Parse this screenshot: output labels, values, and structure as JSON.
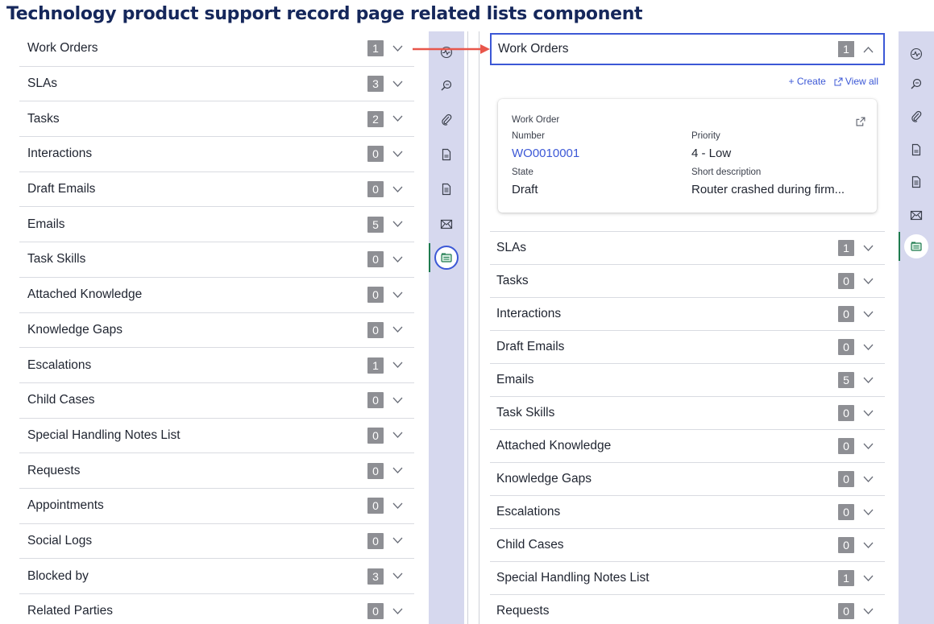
{
  "page_title": "Technology product support record page related lists component",
  "left_list": [
    {
      "label": "Work Orders",
      "count": "1"
    },
    {
      "label": "SLAs",
      "count": "3"
    },
    {
      "label": "Tasks",
      "count": "2"
    },
    {
      "label": "Interactions",
      "count": "0"
    },
    {
      "label": "Draft Emails",
      "count": "0"
    },
    {
      "label": "Emails",
      "count": "5"
    },
    {
      "label": "Task Skills",
      "count": "0"
    },
    {
      "label": "Attached Knowledge",
      "count": "0"
    },
    {
      "label": "Knowledge Gaps",
      "count": "0"
    },
    {
      "label": "Escalations",
      "count": "1"
    },
    {
      "label": "Child Cases",
      "count": "0"
    },
    {
      "label": "Special Handling Notes List",
      "count": "0"
    },
    {
      "label": "Requests",
      "count": "0"
    },
    {
      "label": "Appointments",
      "count": "0"
    },
    {
      "label": "Social Logs",
      "count": "0"
    },
    {
      "label": "Blocked by",
      "count": "3"
    },
    {
      "label": "Related Parties",
      "count": "0"
    }
  ],
  "right_expanded": {
    "label": "Work Orders",
    "count": "1",
    "create_label": "+ Create",
    "view_all_label": "View all",
    "card": {
      "type_label": "Work Order",
      "number_label": "Number",
      "number_value": "WO0010001",
      "priority_label": "Priority",
      "priority_value": "4 - Low",
      "state_label": "State",
      "state_value": "Draft",
      "short_desc_label": "Short description",
      "short_desc_value": "Router crashed during firm..."
    }
  },
  "right_list": [
    {
      "label": "SLAs",
      "count": "1"
    },
    {
      "label": "Tasks",
      "count": "0"
    },
    {
      "label": "Interactions",
      "count": "0"
    },
    {
      "label": "Draft Emails",
      "count": "0"
    },
    {
      "label": "Emails",
      "count": "5"
    },
    {
      "label": "Task Skills",
      "count": "0"
    },
    {
      "label": "Attached Knowledge",
      "count": "0"
    },
    {
      "label": "Knowledge Gaps",
      "count": "0"
    },
    {
      "label": "Escalations",
      "count": "0"
    },
    {
      "label": "Child Cases",
      "count": "0"
    },
    {
      "label": "Special Handling Notes List",
      "count": "1"
    },
    {
      "label": "Requests",
      "count": "0"
    }
  ],
  "rail_icons": [
    "activity-icon",
    "search-knowledge-icon",
    "paperclip-icon",
    "document-icon",
    "document-lines-icon",
    "email-icon",
    "related-lists-icon"
  ],
  "colors": {
    "title": "#15275b",
    "accent": "#3c58d6",
    "rail_bg": "#d6d8ee",
    "count_badge": "#8e8f94",
    "active_bar": "#1e7a4e",
    "arrow": "#e8564b"
  }
}
